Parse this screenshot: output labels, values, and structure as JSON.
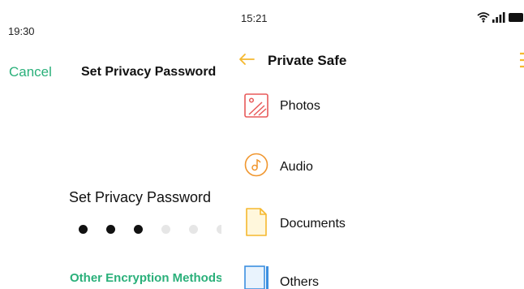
{
  "left_screen": {
    "status_time": "19:30",
    "cancel_label": "Cancel",
    "title": "Set Privacy Password",
    "prompt": "Set Privacy Password",
    "pin": {
      "entered": 3,
      "total": 6
    },
    "other_method_label": "Other Encryption Methods",
    "accent_color": "#2ab07a"
  },
  "right_screen": {
    "status_time": "15:21",
    "title": "Private Safe",
    "accent_color": "#f5b82e",
    "categories": [
      {
        "label": "Photos",
        "icon": "photos-icon",
        "color": "#e85a5a"
      },
      {
        "label": "Audio",
        "icon": "audio-icon",
        "color": "#f0962e"
      },
      {
        "label": "Documents",
        "icon": "documents-icon",
        "color": "#f5b82e"
      },
      {
        "label": "Others",
        "icon": "others-icon",
        "color": "#3c8fe0"
      }
    ]
  }
}
